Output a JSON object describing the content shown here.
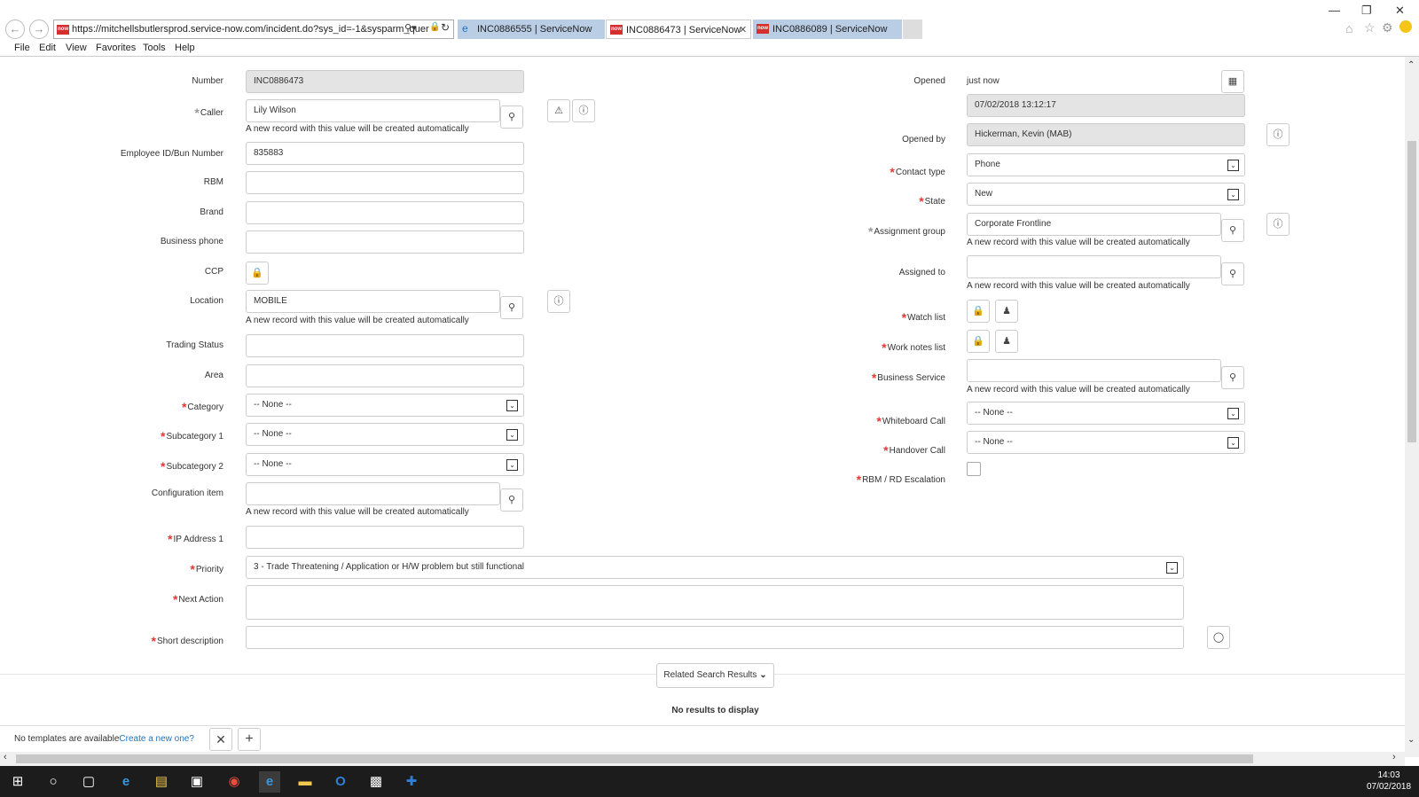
{
  "browser": {
    "url": "https://mitchellsbutlersprod.service-now.com/incident.do?sys_id=-1&sysparm_quer",
    "tabs": [
      {
        "label": "INC0886555 | ServiceNow"
      },
      {
        "label": "INC0886473 | ServiceNow"
      },
      {
        "label": "INC0886089 | ServiceNow"
      }
    ],
    "menu": [
      "File",
      "Edit",
      "View",
      "Favorites",
      "Tools",
      "Help"
    ],
    "favicon_text": "now"
  },
  "form": {
    "left": {
      "number": {
        "label": "Number",
        "value": "INC0886473"
      },
      "caller": {
        "label": "Caller",
        "value": "Lily Wilson",
        "note": "A new record with this value will be created automatically"
      },
      "employee_id": {
        "label": "Employee ID/Bun Number",
        "value": "835883"
      },
      "rbm": {
        "label": "RBM",
        "value": ""
      },
      "brand": {
        "label": "Brand",
        "value": ""
      },
      "business_phone": {
        "label": "Business phone",
        "value": ""
      },
      "ccp": {
        "label": "CCP"
      },
      "location": {
        "label": "Location",
        "value": "MOBILE",
        "note": "A new record with this value will be created automatically"
      },
      "trading_status": {
        "label": "Trading Status",
        "value": ""
      },
      "area": {
        "label": "Area",
        "value": ""
      },
      "category": {
        "label": "Category",
        "value": "-- None --"
      },
      "subcategory1": {
        "label": "Subcategory 1",
        "value": "-- None --"
      },
      "subcategory2": {
        "label": "Subcategory 2",
        "value": "-- None --"
      },
      "config_item": {
        "label": "Configuration item",
        "value": "",
        "note": "A new record with this value will be created automatically"
      },
      "ip_address": {
        "label": "IP Address 1",
        "value": ""
      },
      "priority": {
        "label": "Priority",
        "value": "3 - Trade Threatening / Application or H/W problem but still functional"
      },
      "next_action": {
        "label": "Next Action",
        "value": ""
      },
      "short_description": {
        "label": "Short description",
        "value": ""
      }
    },
    "right": {
      "opened": {
        "label": "Opened",
        "value": "just now",
        "datetime": "07/02/2018 13:12:17"
      },
      "opened_by": {
        "label": "Opened by",
        "value": "Hickerman, Kevin (MAB)"
      },
      "contact_type": {
        "label": "Contact type",
        "value": "Phone"
      },
      "state": {
        "label": "State",
        "value": "New"
      },
      "assignment_group": {
        "label": "Assignment group",
        "value": "Corporate Frontline",
        "note": "A new record with this value will be created automatically"
      },
      "assigned_to": {
        "label": "Assigned to",
        "value": "",
        "note": "A new record with this value will be created automatically"
      },
      "watch_list": {
        "label": "Watch list"
      },
      "work_notes_list": {
        "label": "Work notes list"
      },
      "business_service": {
        "label": "Business Service",
        "value": "",
        "note": "A new record with this value will be created automatically"
      },
      "whiteboard_call": {
        "label": "Whiteboard Call",
        "value": "-- None --"
      },
      "handover_call": {
        "label": "Handover Call",
        "value": "-- None --"
      },
      "rbm_escalation": {
        "label": "RBM / RD Escalation",
        "checked": false
      }
    }
  },
  "related": {
    "button": "Related Search Results",
    "empty": "No results to display"
  },
  "templates": {
    "text": "No templates are available",
    "link": "Create a new one?"
  },
  "taskbar": {
    "time": "14:03",
    "date": "07/02/2018"
  }
}
